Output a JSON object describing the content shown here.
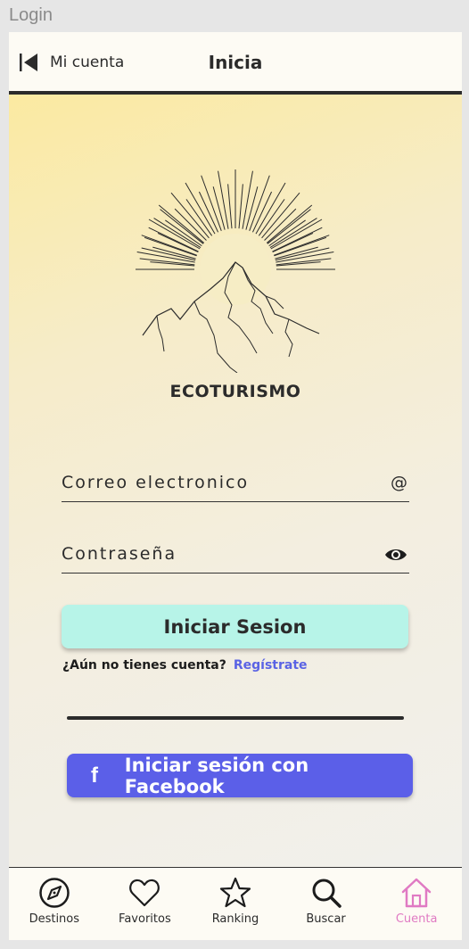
{
  "window": {
    "title": "Login"
  },
  "topbar": {
    "back_label": "Mi cuenta",
    "title": "Inicia"
  },
  "brand": {
    "name": "ECOTURISMO"
  },
  "form": {
    "email_label": "Correo electronico",
    "email_icon": "@",
    "password_label": "Contraseña",
    "password_icon": "eye-icon",
    "login_button": "Iniciar Sesion",
    "no_account_text": "¿Aún no tienes cuenta?",
    "register_link": "Regístrate",
    "facebook_button": "Iniciar sesión con Facebook"
  },
  "nav": {
    "items": [
      {
        "label": "Destinos",
        "icon": "compass-icon"
      },
      {
        "label": "Favoritos",
        "icon": "heart-icon"
      },
      {
        "label": "Ranking",
        "icon": "star-icon"
      },
      {
        "label": "Buscar",
        "icon": "search-icon"
      },
      {
        "label": "Cuenta",
        "icon": "home-icon"
      }
    ],
    "active": "Cuenta"
  },
  "colors": {
    "login_button": "#b7f4e8",
    "facebook_button": "#5b5fe8",
    "link": "#5a63e4",
    "active_nav": "#e07ac3"
  }
}
